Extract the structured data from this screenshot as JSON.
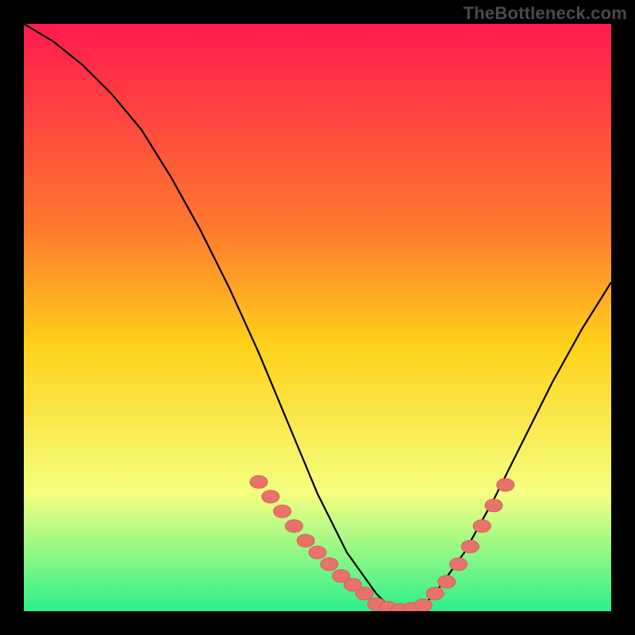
{
  "watermark": "TheBottleneck.com",
  "colors": {
    "background": "#000000",
    "gradient_top": "#ff1a4f",
    "gradient_mid_upper": "#ff7a2e",
    "gradient_mid": "#ffd21a",
    "gradient_lower": "#f5ff80",
    "gradient_bottom": "#2cf08a",
    "curve": "#000000",
    "marker_fill": "#e8736d",
    "marker_stroke": "#d85f5a"
  },
  "chart_data": {
    "type": "line",
    "title": "",
    "xlabel": "",
    "ylabel": "",
    "xlim": [
      0,
      100
    ],
    "ylim": [
      0,
      100
    ],
    "x": [
      0,
      5,
      10,
      15,
      20,
      25,
      30,
      35,
      40,
      45,
      50,
      55,
      60,
      62,
      65,
      68,
      70,
      75,
      80,
      85,
      90,
      95,
      100
    ],
    "values": [
      100,
      97,
      93,
      88,
      82,
      74,
      65,
      55,
      44,
      32,
      20,
      10,
      3,
      1,
      0,
      1,
      3,
      10,
      19,
      29,
      39,
      48,
      56
    ],
    "markers_left": {
      "x": [
        40,
        42,
        44,
        46,
        48,
        50,
        52,
        54,
        56,
        58
      ],
      "y": [
        22,
        19.5,
        17,
        14.5,
        12,
        10,
        8,
        6,
        4.5,
        3
      ]
    },
    "markers_bottom": {
      "x": [
        60,
        62,
        64,
        66,
        68
      ],
      "y": [
        1.2,
        0.6,
        0.2,
        0.4,
        1.0
      ]
    },
    "markers_right": {
      "x": [
        70,
        72,
        74,
        76,
        78,
        80,
        82
      ],
      "y": [
        3,
        5,
        8,
        11,
        14.5,
        18,
        21.5
      ]
    }
  }
}
